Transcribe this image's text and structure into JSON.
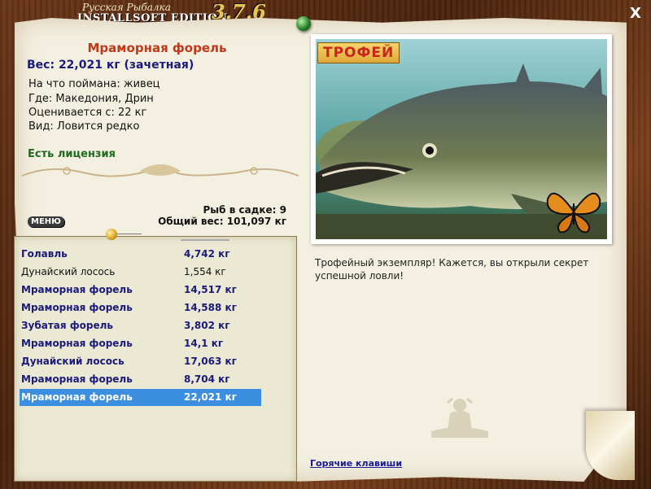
{
  "app": {
    "brand": "Русская Рыбалка",
    "edition": "INSTALLSOFT EDITION",
    "version": "3.7.6",
    "close_label": "X"
  },
  "fish": {
    "name": "Мраморная форель",
    "weight": "Вес: 22,021 кг (зачетная)",
    "caught_on": "На что поймана: живец",
    "location": "Где: Македония, Дрин",
    "valued_from": "Оценивается с: 22 кг",
    "rarity": "Вид: Ловится редко",
    "license": "Есть лицензия"
  },
  "stats": {
    "fish_count": "Рыб в садке: 9",
    "total_weight": "Общий вес: 101,097 кг"
  },
  "menu_label": "МЕНЮ",
  "catch_list": [
    {
      "name": "Голавль",
      "weight": "4,742 кг",
      "style": "bold"
    },
    {
      "name": "Дунайский лосось",
      "weight": "1,554 кг",
      "style": "plain"
    },
    {
      "name": "Мраморная форель",
      "weight": "14,517 кг",
      "style": "bold"
    },
    {
      "name": "Мраморная форель",
      "weight": "14,588 кг",
      "style": "bold"
    },
    {
      "name": "Зубатая форель",
      "weight": "3,802 кг",
      "style": "bold"
    },
    {
      "name": "Мраморная форель",
      "weight": "14,1 кг",
      "style": "bold"
    },
    {
      "name": "Дунайский лосось",
      "weight": "17,063 кг",
      "style": "bold"
    },
    {
      "name": "Мраморная форель",
      "weight": "8,704 кг",
      "style": "bold"
    },
    {
      "name": "Мраморная форель",
      "weight": "22,021 кг",
      "style": "selected"
    }
  ],
  "photo": {
    "badge": "ТРОФЕЙ"
  },
  "description": "Трофейный экземпляр! Кажется, вы открыли секрет успешной ловли!",
  "hotkeys_label": "Горячие клавиши",
  "colors": {
    "fish_name": "#c0391a",
    "link": "#1a1a9a",
    "selected_row": "#3b8ee0",
    "license": "#1d6b1d"
  }
}
